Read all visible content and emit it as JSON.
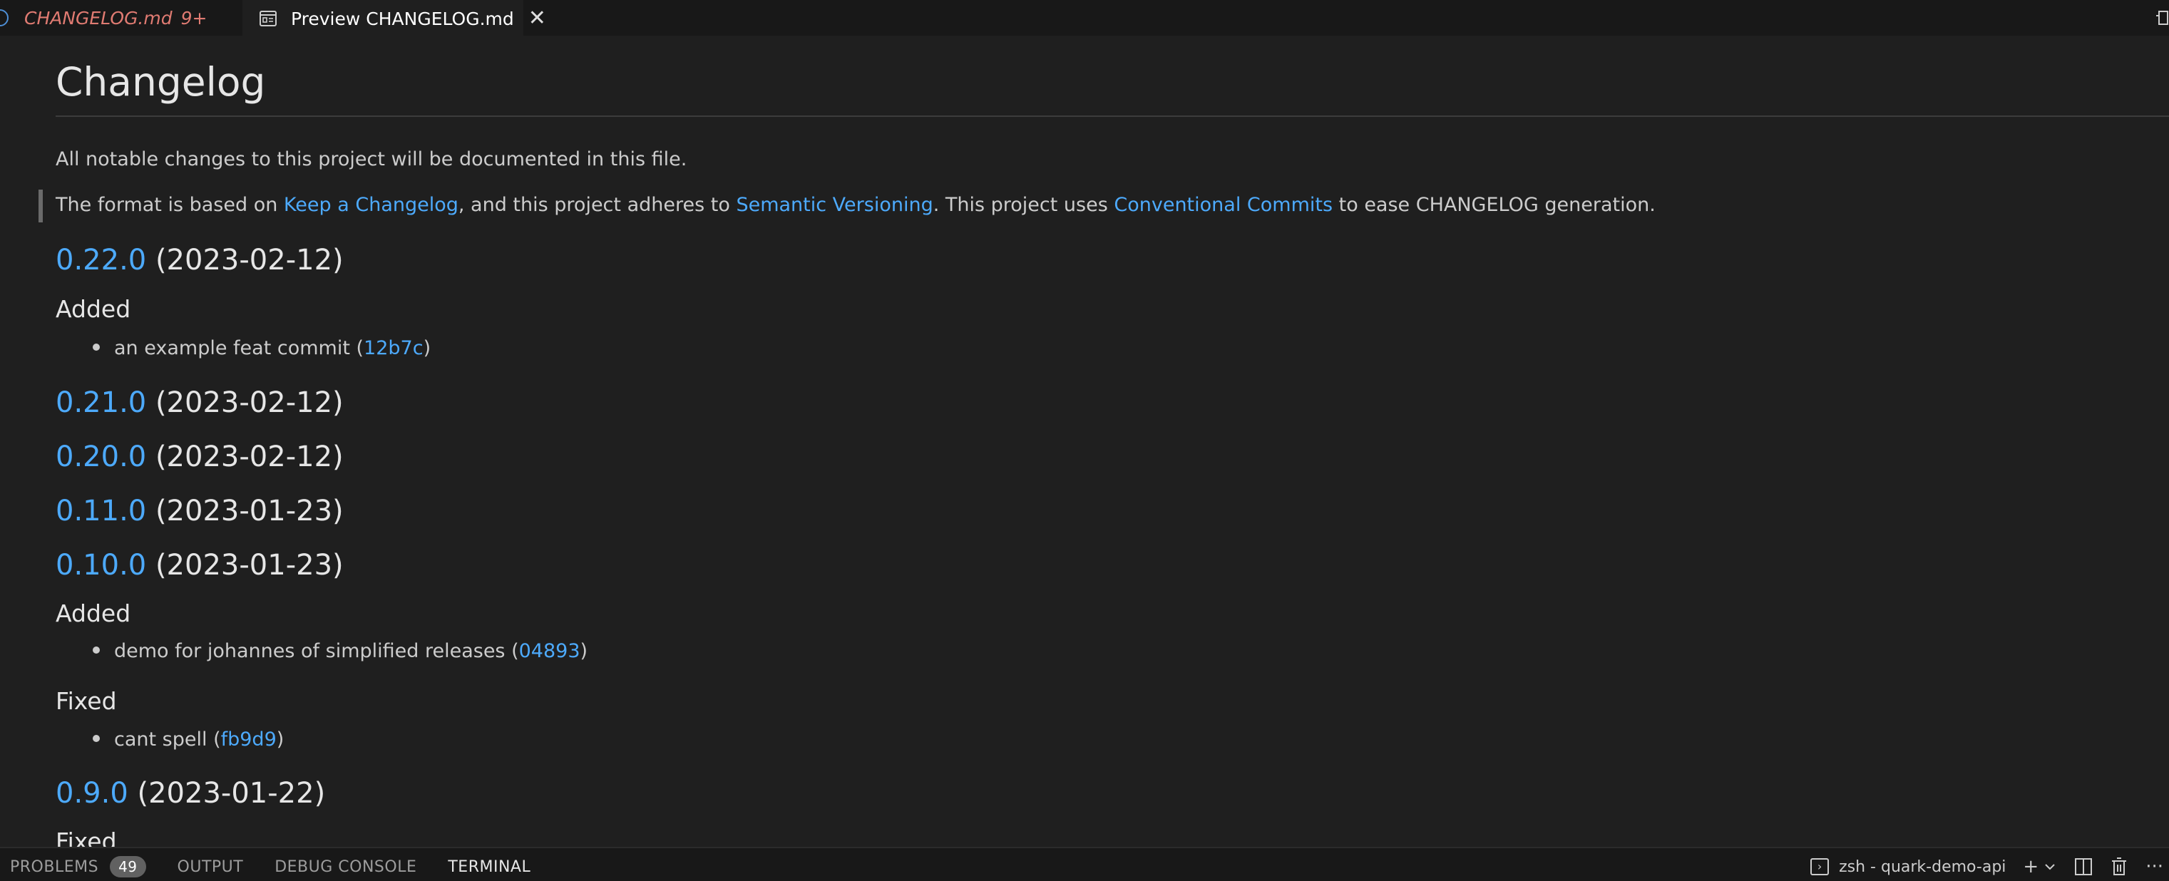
{
  "tabs": [
    {
      "label": "CHANGELOG.md",
      "badge": "9+",
      "active": false
    },
    {
      "label": "Preview CHANGELOG.md",
      "active": true
    }
  ],
  "tab_close_symbol": "✕",
  "doc": {
    "title": "Changelog",
    "intro": "All notable changes to this project will be documented in this file.",
    "format": {
      "text1": "The format is based on ",
      "link1": "Keep a Changelog",
      "text2": ", and this project adheres to ",
      "link2": "Semantic Versioning",
      "text3": ". This project uses ",
      "link3": "Conventional Commits",
      "text4": " to ease CHANGELOG generation."
    },
    "releases": [
      {
        "version": "0.22.0",
        "date": "(2023-02-12)"
      },
      {
        "version": "0.21.0",
        "date": "(2023-02-12)"
      },
      {
        "version": "0.20.0",
        "date": "(2023-02-12)"
      },
      {
        "version": "0.11.0",
        "date": "(2023-01-23)"
      },
      {
        "version": "0.10.0",
        "date": "(2023-01-23)"
      },
      {
        "version": "0.9.0",
        "date": "(2023-01-22)"
      }
    ],
    "sections": {
      "added_1": "Added",
      "added_2": "Added",
      "fixed_1": "Fixed",
      "fixed_2": "Fixed"
    },
    "items": [
      {
        "text": "an example feat commit (",
        "hash": "12b7c",
        "close": ")"
      },
      {
        "text": "demo for johannes of simplified releases (",
        "hash": "04893",
        "close": ")"
      },
      {
        "text": "cant spell (",
        "hash": "fb9d9",
        "close": ")"
      }
    ]
  },
  "panel": {
    "tabs": [
      "PROBLEMS",
      "OUTPUT",
      "DEBUG CONSOLE",
      "TERMINAL"
    ],
    "problems_count": "49",
    "active_tab": "TERMINAL",
    "terminal_name": "zsh - quark-demo-api",
    "add_symbol": "+",
    "more_symbol": "···"
  },
  "colors": {
    "link": "#4daafc",
    "editor_bg": "#1f1f1f",
    "tab_modified": "#e07b72"
  },
  "icons": [
    "preview-icon",
    "close-icon",
    "layout-icon",
    "terminal-icon",
    "plus-icon",
    "chevron-down-icon",
    "split-icon",
    "trash-icon",
    "more-icon"
  ]
}
